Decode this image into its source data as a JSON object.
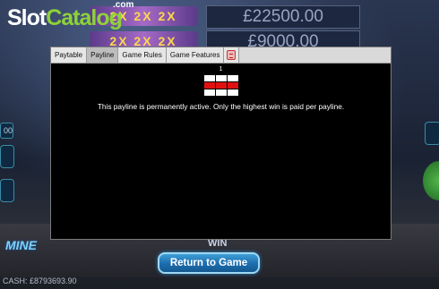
{
  "brand": {
    "slot": "Slot",
    "catalog": "Catalog",
    "com": ".com"
  },
  "game": {
    "top_win_1": "£22500.00",
    "top_win_2": "£9000.00",
    "multiplier_strip": "2X 2X 2X",
    "win_label": "WIN",
    "side_value": "00",
    "cash_label": "CASH: £8793693.90"
  },
  "dialog": {
    "tabs": [
      "Paytable",
      "Payline",
      "Game Rules",
      "Game Features"
    ],
    "active_tab": "Payline",
    "payline_number": "1",
    "payline_pattern": [
      [
        false,
        false,
        false
      ],
      [
        true,
        true,
        true
      ],
      [
        false,
        false,
        false
      ]
    ],
    "description": "This payline is permanently active. Only the highest win is paid per payline."
  },
  "return_button": "Return to Game",
  "colors": {
    "payline_on": "#e01010",
    "button_blue": "#1c6cae",
    "brand_green": "#8ed13a"
  }
}
